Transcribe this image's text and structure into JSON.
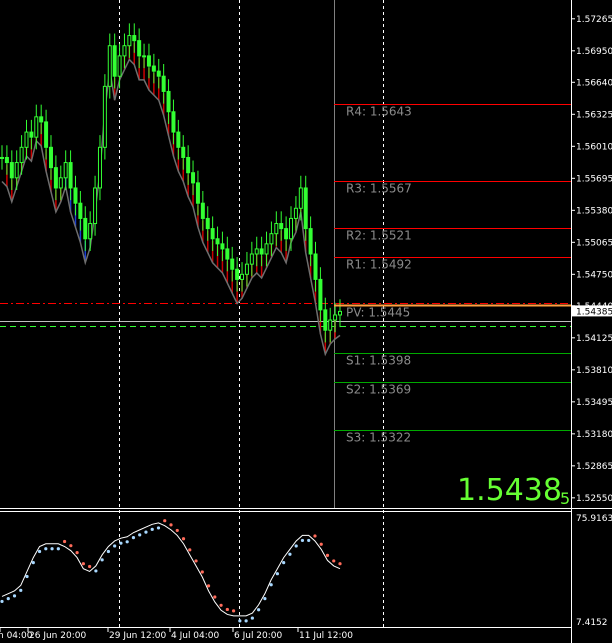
{
  "chart_data": {
    "type": "candlestick",
    "price_axis": {
      "ticks": [
        "1.57265",
        "1.56950",
        "1.56640",
        "1.56325",
        "1.56010",
        "1.55695",
        "1.55380",
        "1.55065",
        "1.54750",
        "1.54440",
        "1.54125",
        "1.53810",
        "1.53495",
        "1.53180",
        "1.52865",
        "1.52550"
      ],
      "current_price_label": "1.54385"
    },
    "time_axis": {
      "ticks": [
        "n 04:00",
        "26 Jun 20:00",
        "29 Jun 12:00",
        "4 Jul 04:00",
        "6 Jul 20:00",
        "11 Jul 12:00"
      ]
    },
    "pivot_levels": [
      {
        "name": "R4",
        "label": "R4: 1.5643",
        "value": 1.5643,
        "color": "#ff0000"
      },
      {
        "name": "R3",
        "label": "R3: 1.5567",
        "value": 1.5567,
        "color": "#ff0000"
      },
      {
        "name": "R2",
        "label": "R2: 1.5521",
        "value": 1.5521,
        "color": "#ff0000"
      },
      {
        "name": "R1",
        "label": "R1: 1.5492",
        "value": 1.5492,
        "color": "#ff0000"
      },
      {
        "name": "PV",
        "label": "PV: 1.5445",
        "value": 1.5445,
        "color": "#ffa040"
      },
      {
        "name": "S1",
        "label": "S1: 1.5398",
        "value": 1.5398,
        "color": "#00aa00"
      },
      {
        "name": "S2",
        "label": "S2: 1.5369",
        "value": 1.5369,
        "color": "#00aa00"
      },
      {
        "name": "S3",
        "label": "S3: 1.5322",
        "value": 1.5322,
        "color": "#00aa00"
      }
    ],
    "big_price": {
      "main": "1.5438",
      "sub": "5"
    },
    "close_series": [
      1.559,
      1.5585,
      1.557,
      1.5585,
      1.56,
      1.5615,
      1.561,
      1.563,
      1.5625,
      1.56,
      1.558,
      1.556,
      1.557,
      1.5585,
      1.556,
      1.5545,
      1.553,
      1.551,
      1.5525,
      1.556,
      1.56,
      1.566,
      1.57,
      1.567,
      1.569,
      1.57,
      1.571,
      1.5705,
      1.569,
      1.569,
      1.568,
      1.5675,
      1.567,
      1.5655,
      1.5635,
      1.5615,
      1.56,
      1.559,
      1.5575,
      1.5565,
      1.5545,
      1.553,
      1.552,
      1.551,
      1.5505,
      1.55,
      1.549,
      1.548,
      1.547,
      1.5475,
      1.5485,
      1.5495,
      1.55,
      1.5495,
      1.5505,
      1.5515,
      1.5525,
      1.552,
      1.551,
      1.553,
      1.554,
      1.556,
      1.552,
      1.5495,
      1.547,
      1.544,
      1.542,
      1.543,
      1.5435,
      1.54385
    ],
    "red_bands": [
      {
        "from": 0,
        "to": 13,
        "lower": "mid"
      },
      {
        "from": 13,
        "to": 22,
        "note": "blue band"
      },
      {
        "from": 24,
        "to": 69,
        "lower": "mid"
      }
    ],
    "oscillator": {
      "max_label": "75.9163",
      "min_label": "7.4152",
      "line": [
        22,
        24,
        26,
        30,
        40,
        50,
        58,
        60,
        60,
        60,
        58,
        55,
        50,
        42,
        40,
        44,
        52,
        58,
        62,
        64,
        65,
        68,
        70,
        72,
        74,
        75,
        73,
        70,
        66,
        60,
        52,
        44,
        36,
        26,
        18,
        12,
        9,
        8,
        8,
        8,
        10,
        16,
        24,
        34,
        42,
        50,
        56,
        62,
        66,
        66,
        62,
        56,
        48,
        44,
        42
      ]
    },
    "colors": {
      "bull": "#33ff33",
      "bear": "#33ff33",
      "grid": "#ffffff",
      "pivot_red": "#ff0000",
      "pivot_green": "#00aa00",
      "pivot_pv": "#ffa040",
      "dots_up": "#a8d8ff",
      "dots_down": "#ff6b5a",
      "band_red": "#cc0000",
      "band_blue": "#1a3fcf"
    }
  }
}
